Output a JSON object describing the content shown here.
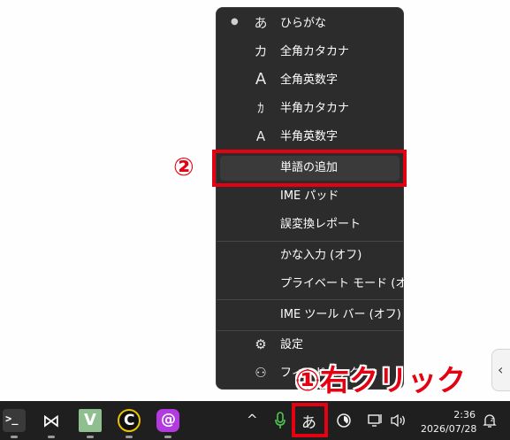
{
  "menu": {
    "items": [
      {
        "glyph": "あ",
        "label": "ひらがな",
        "selected": true
      },
      {
        "glyph": "カ",
        "label": "全角カタカナ"
      },
      {
        "glyph": "A",
        "label": "全角英数字"
      },
      {
        "glyph": "ｶ",
        "label": "半角カタカナ"
      },
      {
        "glyph": "A",
        "label": "半角英数字"
      },
      {
        "label": "単語の追加"
      },
      {
        "label": "IME パッド"
      },
      {
        "label": "誤変換レポート"
      },
      {
        "label": "かな入力 (オフ)"
      },
      {
        "label": "プライベート モード (オフ)"
      },
      {
        "label": "IME ツール バー (オフ)"
      },
      {
        "glyph": "⚙",
        "label": "設定"
      },
      {
        "glyph": "⚇",
        "label": "フィードバック"
      }
    ]
  },
  "annotations": {
    "step2": "②",
    "step1": "①右クリック"
  },
  "taskbar": {
    "apps": [
      {
        "name": "terminal",
        "text": ">_",
        "color": "#3a3a3a"
      },
      {
        "name": "app-x",
        "text": "⋈",
        "color": "#1f1f1f"
      },
      {
        "name": "app-v",
        "text": "V",
        "color": "#8fbf8f"
      },
      {
        "name": "app-c",
        "text": "C",
        "color": "#111111"
      },
      {
        "name": "app-at",
        "text": "@",
        "color": "#b23adf"
      }
    ],
    "tray": {
      "chevron": "^",
      "ime_indicator": "あ",
      "time": "2:36",
      "date": "2026/07/28"
    }
  },
  "side_tab": {
    "glyph": "‹"
  }
}
